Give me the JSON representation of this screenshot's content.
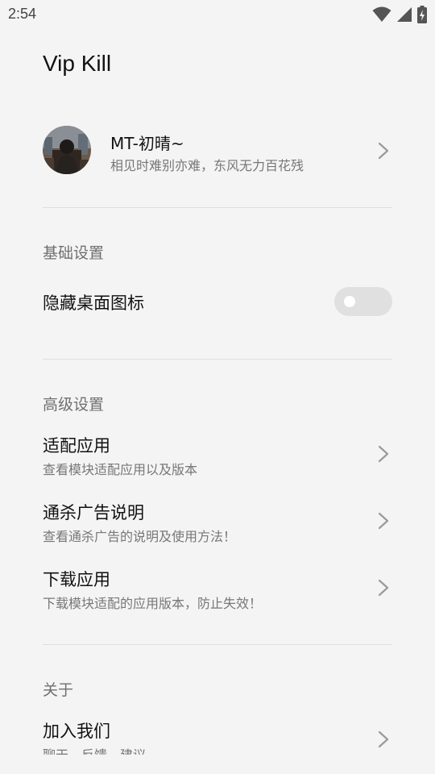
{
  "status_bar": {
    "time": "2:54",
    "icons": [
      "wifi-icon",
      "signal-icon",
      "battery-charging-icon"
    ]
  },
  "app": {
    "title": "Vip Kill"
  },
  "profile": {
    "name": "MT-初晴~",
    "subtitle": "相见时难别亦难，东风无力百花残"
  },
  "basic_settings": {
    "header": "基础设置",
    "hide_icon": {
      "label": "隐藏桌面图标",
      "enabled": false
    }
  },
  "advanced_settings": {
    "header": "高级设置",
    "items": [
      {
        "title": "适配应用",
        "subtitle": "查看模块适配应用以及版本"
      },
      {
        "title": "通杀广告说明",
        "subtitle": "查看通杀广告的说明及使用方法！"
      },
      {
        "title": "下载应用",
        "subtitle": "下载模块适配的应用版本，防止失效！"
      }
    ]
  },
  "about": {
    "header": "关于",
    "items": [
      {
        "title": "加入我们",
        "subtitle": "聊天、反馈、建议"
      }
    ]
  },
  "colors": {
    "background": "#f4f4f4",
    "toggle_off": "#e0e0e0",
    "divider": "#dedede"
  }
}
